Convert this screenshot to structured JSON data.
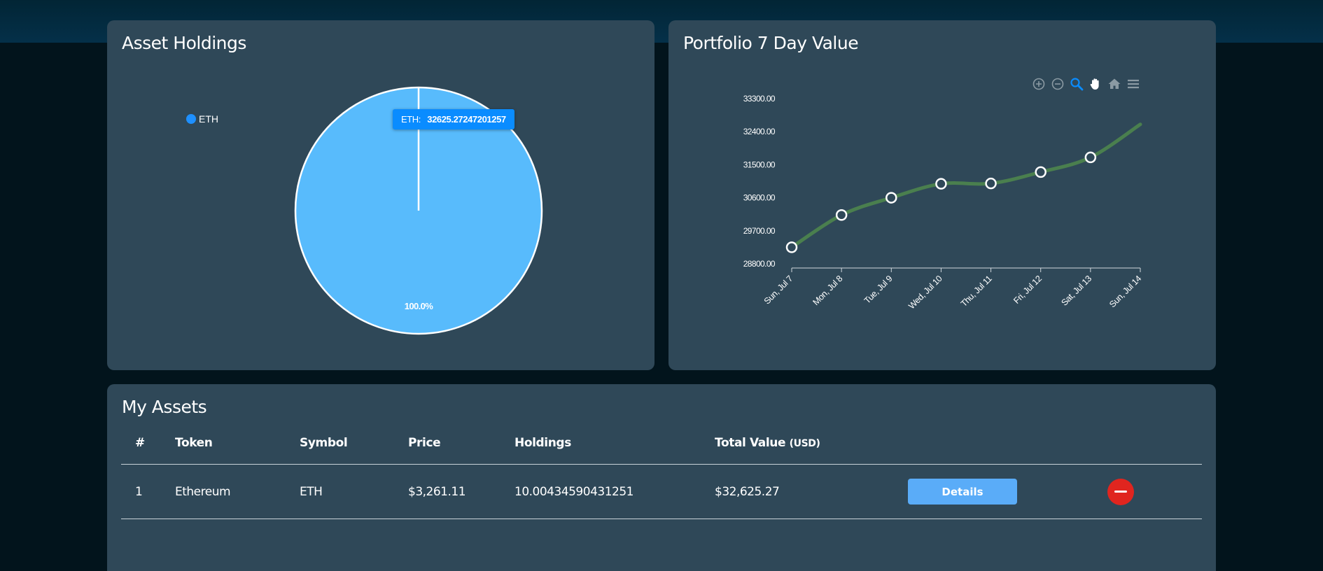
{
  "asset_holdings": {
    "title": "Asset Holdings",
    "legend": [
      {
        "label": "ETH",
        "color": "#1e90ff"
      }
    ],
    "slice_color": "#58bbfc",
    "slice_percent_label": "100.0%",
    "tooltip": {
      "label": "ETH:",
      "value": "32625.27247201257"
    }
  },
  "portfolio": {
    "title": "Portfolio 7 Day Value",
    "line_color": "#4a7f4e",
    "toolbar": [
      "zoom-in-icon",
      "zoom-out-icon",
      "selection-zoom-icon",
      "pan-hand-icon",
      "reset-home-icon",
      "menu-icon"
    ]
  },
  "chart_data": {
    "type": "line",
    "title": "",
    "xlabel": "",
    "ylabel": "",
    "categories": [
      "Sun, Jul 7",
      "Mon, Jul 8",
      "Tue, Jul 9",
      "Wed, Jul 10",
      "Thu, Jul 11",
      "Fri, Jul 12",
      "Sat, Jul 13",
      "Sun, Jul 14"
    ],
    "series": [
      {
        "values": [
          29250,
          30130,
          30600,
          30980,
          30990,
          31300,
          31700,
          32600
        ]
      }
    ],
    "yticks": [
      "33300.00",
      "32400.00",
      "31500.00",
      "30600.00",
      "29700.00",
      "28800.00"
    ],
    "ylim": [
      28800,
      33300
    ],
    "markers_on": [
      0,
      1,
      2,
      3,
      4,
      5,
      6
    ]
  },
  "my_assets": {
    "title": "My Assets",
    "columns": {
      "index": "#",
      "token": "Token",
      "symbol": "Symbol",
      "price": "Price",
      "holdings": "Holdings",
      "total": "Total Value",
      "total_unit": "(USD)"
    },
    "rows": [
      {
        "index": "1",
        "token": "Ethereum",
        "symbol": "ETH",
        "price": "$3,261.11",
        "holdings": "10.00434590431251",
        "total": "$32,625.27",
        "details_label": "Details"
      }
    ]
  }
}
